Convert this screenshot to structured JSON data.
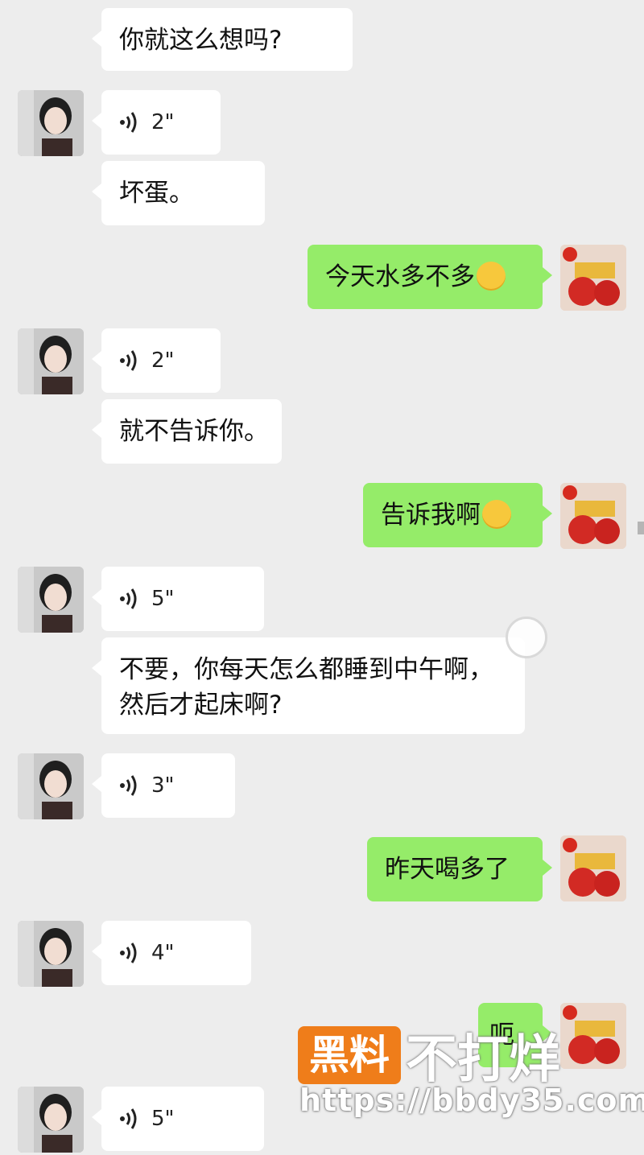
{
  "messages": [
    {
      "side": "left",
      "type": "text",
      "text": "你就这么想吗?"
    },
    {
      "side": "left",
      "type": "voice",
      "duration": "2\""
    },
    {
      "side": "left",
      "type": "text",
      "text": "坏蛋。"
    },
    {
      "side": "right",
      "type": "text",
      "text": "今天水多不多",
      "emoji": "grinning-emoji"
    },
    {
      "side": "left",
      "type": "voice",
      "duration": "2\""
    },
    {
      "side": "left",
      "type": "text",
      "text": "就不告诉你。"
    },
    {
      "side": "right",
      "type": "text",
      "text": "告诉我啊",
      "emoji": "kissing-emoji"
    },
    {
      "side": "left",
      "type": "voice",
      "duration": "5\""
    },
    {
      "side": "left",
      "type": "text",
      "text": "不要，你每天怎么都睡到中午啊，然后才起床啊?"
    },
    {
      "side": "left",
      "type": "voice",
      "duration": "3\""
    },
    {
      "side": "right",
      "type": "text",
      "text": "昨天喝多了"
    },
    {
      "side": "left",
      "type": "voice",
      "duration": "4\""
    },
    {
      "side": "right",
      "type": "text",
      "text": "呃"
    },
    {
      "side": "left",
      "type": "voice",
      "duration": "5\""
    }
  ],
  "watermark": {
    "badge": "黑料",
    "text": "不打烊",
    "url": "https://bbdy35.com"
  },
  "colors": {
    "background": "#ededed",
    "incoming": "#ffffff",
    "outgoing": "#95ec69",
    "watermark": "#ef7d1a"
  },
  "icons": {
    "voice": "voice-wave-icon",
    "avatar_left": "female-avatar",
    "avatar_right": "lucky-bags-avatar"
  }
}
